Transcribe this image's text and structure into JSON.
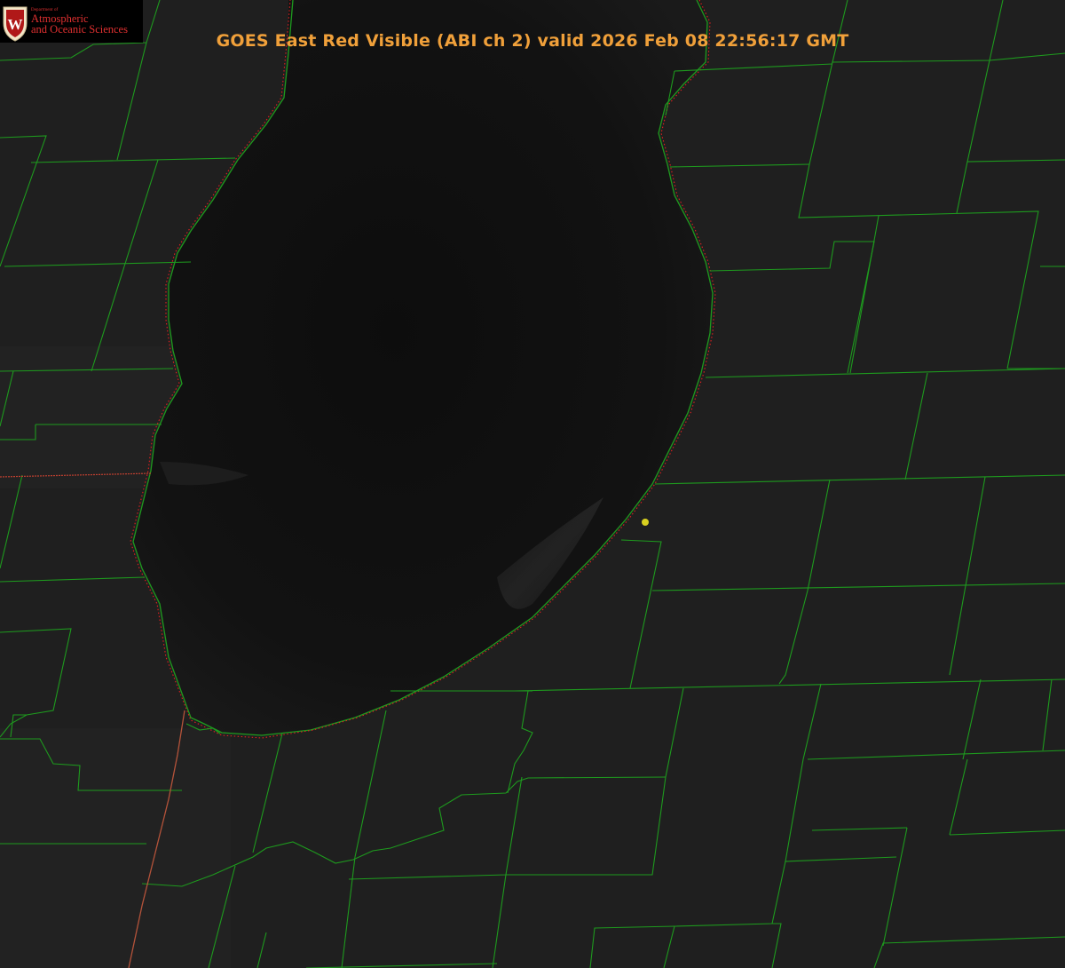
{
  "title": "GOES East Red Visible (ABI ch 2) valid 2026 Feb 08 22:56:17 GMT",
  "logo": {
    "department_label": "Department of",
    "line1": "Atmospheric",
    "line2": "and Oceanic Sciences",
    "emblem_letter": "W",
    "icon": "uw-crest-icon"
  },
  "colors": {
    "background": "#000000",
    "land": "#1f1f1f",
    "lake": "#121212",
    "county_lines": "#1e9a1e",
    "state_line": "#b4533a",
    "shoreline_dots": "#e02020",
    "title_text": "#f0a03a",
    "logo_text": "#e03030",
    "marker": "#d8d020"
  },
  "map": {
    "imagery": "GOES East Red Visible (ABI ch 2)",
    "feature_lake": "Lake Michigan (southern basin)",
    "marker": "station-marker-icon"
  }
}
